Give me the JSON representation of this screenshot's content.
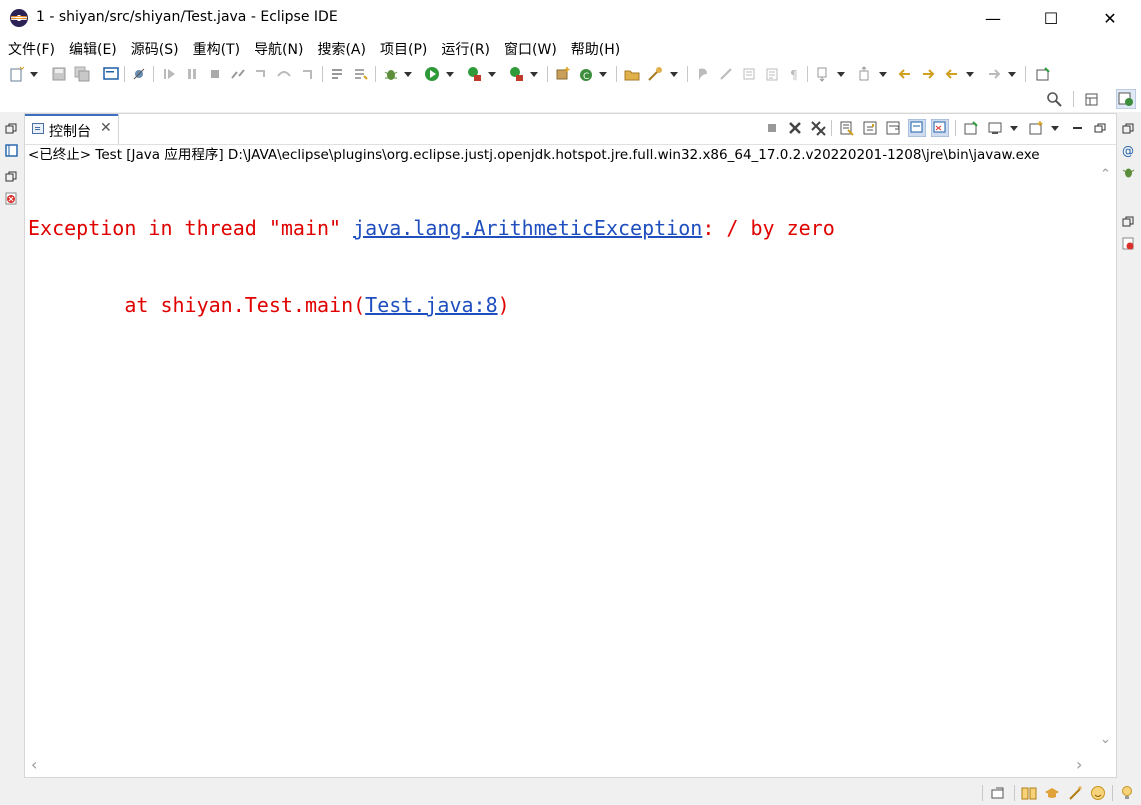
{
  "window": {
    "title": "1 - shiyan/src/shiyan/Test.java - Eclipse IDE",
    "minimize_glyph": "—",
    "maximize_glyph": "☐",
    "close_glyph": "✕"
  },
  "menu": [
    "文件(F)",
    "编辑(E)",
    "源码(S)",
    "重构(T)",
    "导航(N)",
    "搜索(A)",
    "项目(P)",
    "运行(R)",
    "窗口(W)",
    "帮助(H)"
  ],
  "console": {
    "tab_label": "控制台",
    "tab_close": "✕",
    "description": "<已终止> Test [Java 应用程序] D:\\JAVA\\eclipse\\plugins\\org.eclipse.justj.openjdk.hotspot.jre.full.win32.x86_64_17.0.2.v20220201-1208\\jre\\bin\\javaw.exe",
    "line1_prefix": "Exception in thread \"main\" ",
    "line1_link": "java.lang.ArithmeticException",
    "line1_suffix": ": / by zero",
    "line2_prefix": "        at shiyan.Test.main(",
    "line2_link": "Test.java:8",
    "line2_suffix": ")",
    "error_color": "#e00000",
    "link_color": "#1f4fbf"
  },
  "scroll": {
    "up": "⌃",
    "down": "⌄",
    "left": "‹",
    "right": "›"
  }
}
